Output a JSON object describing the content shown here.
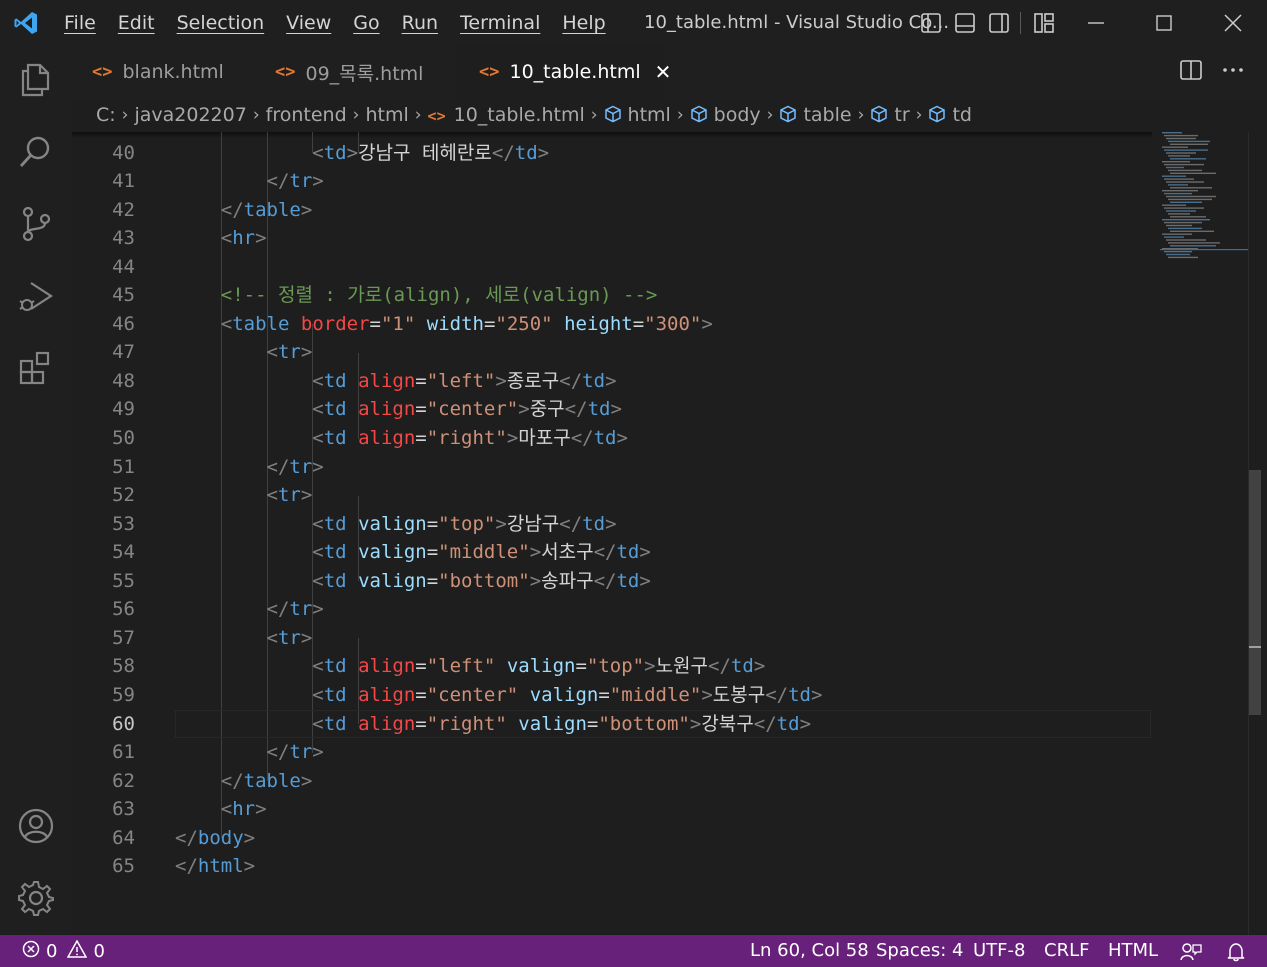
{
  "menu": [
    "File",
    "Edit",
    "Selection",
    "View",
    "Go",
    "Run",
    "Terminal",
    "Help"
  ],
  "window_title": "10_table.html - Visual Studio Co...",
  "tabs": [
    {
      "label": "blank.html",
      "icon": "<>"
    },
    {
      "label": "09_목록.html",
      "icon": "<>"
    },
    {
      "label": "10_table.html",
      "icon": "<>",
      "close": "✕"
    }
  ],
  "breadcrumb": [
    "C:",
    "java202207",
    "frontend",
    "html",
    "10_table.html",
    "html",
    "body",
    "table",
    "tr",
    "td"
  ],
  "line_numbers": [
    "40",
    "41",
    "42",
    "43",
    "44",
    "45",
    "46",
    "47",
    "48",
    "49",
    "50",
    "51",
    "52",
    "53",
    "54",
    "55",
    "56",
    "57",
    "58",
    "59",
    "60",
    "61",
    "62",
    "63",
    "64",
    "65"
  ],
  "code_lines": [
    "            <td>강남구 테헤란로</td>",
    "        </tr>",
    "    </table>",
    "    <hr>",
    "",
    "    <!-- 정렬 : 가로(align), 세로(valign) -->",
    "    <table border=\"1\" width=\"250\" height=\"300\">",
    "        <tr>",
    "            <td align=\"left\">종로구</td>",
    "            <td align=\"center\">중구</td>",
    "            <td align=\"right\">마포구</td>",
    "        </tr>",
    "        <tr>",
    "            <td valign=\"top\">강남구</td>",
    "            <td valign=\"middle\">서초구</td>",
    "            <td valign=\"bottom\">송파구</td>",
    "        </tr>",
    "        <tr>",
    "            <td align=\"left\" valign=\"top\">노원구</td>",
    "            <td align=\"center\" valign=\"middle\">도봉구</td>",
    "            <td align=\"right\" valign=\"bottom\">강북구</td>",
    "        </tr>",
    "    </table>",
    "    <hr>",
    "</body>",
    "</html>"
  ],
  "current_line": "60",
  "status": {
    "errors": "0",
    "warnings": "0",
    "position": "Ln 60, Col 58",
    "spaces": "Spaces: 4",
    "encoding": "UTF-8",
    "eol": "CRLF",
    "language": "HTML"
  },
  "colors": {
    "status_bar": "#68217a",
    "editor_bg": "#1e1e1e",
    "tag": "#569cd6",
    "attribute": "#9cdcfe",
    "deprecated_attribute": "#f44747",
    "string": "#ce9178",
    "comment": "#6a9955"
  }
}
